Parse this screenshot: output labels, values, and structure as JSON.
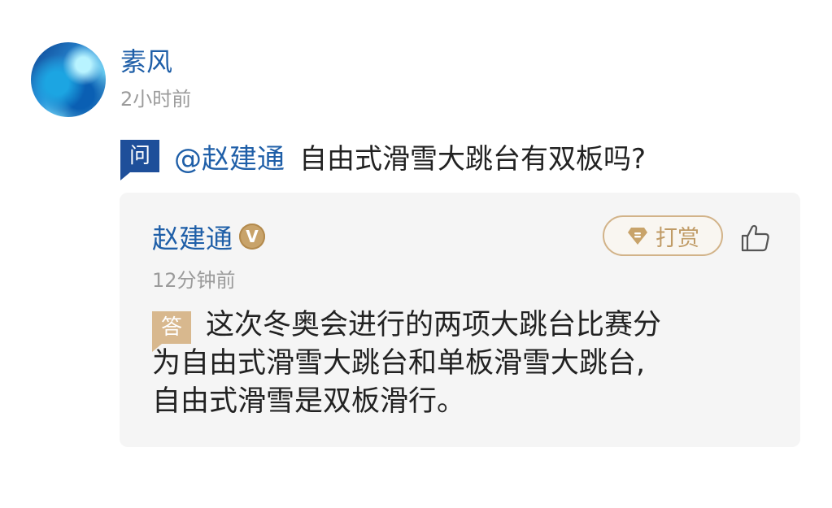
{
  "post": {
    "user_name": "素风",
    "time": "2小时前",
    "question": {
      "badge": "问",
      "mention": "@赵建通",
      "text": "自由式滑雪大跳台有双板吗?"
    }
  },
  "answer": {
    "user_name": "赵建通",
    "verified_badge": "V",
    "reward_label": "打赏",
    "time": "12分钟前",
    "badge": "答",
    "lines": [
      "这次冬奥会进行的两项大跳台比赛分",
      "为自由式滑雪大跳台和单板滑雪大跳台,",
      "自由式滑雪是双板滑行。"
    ]
  },
  "icons": {
    "avatar": "avatar-image",
    "verified": "verified-v-icon",
    "reward": "gem-icon",
    "like": "thumbs-up-icon"
  },
  "colors": {
    "link_blue": "#1f5fa8",
    "question_badge": "#1e4f9a",
    "answer_badge": "#d8b88e",
    "reward_gold": "#c09b66",
    "muted_text": "#9b9b9b",
    "card_background": "#f5f5f5"
  }
}
